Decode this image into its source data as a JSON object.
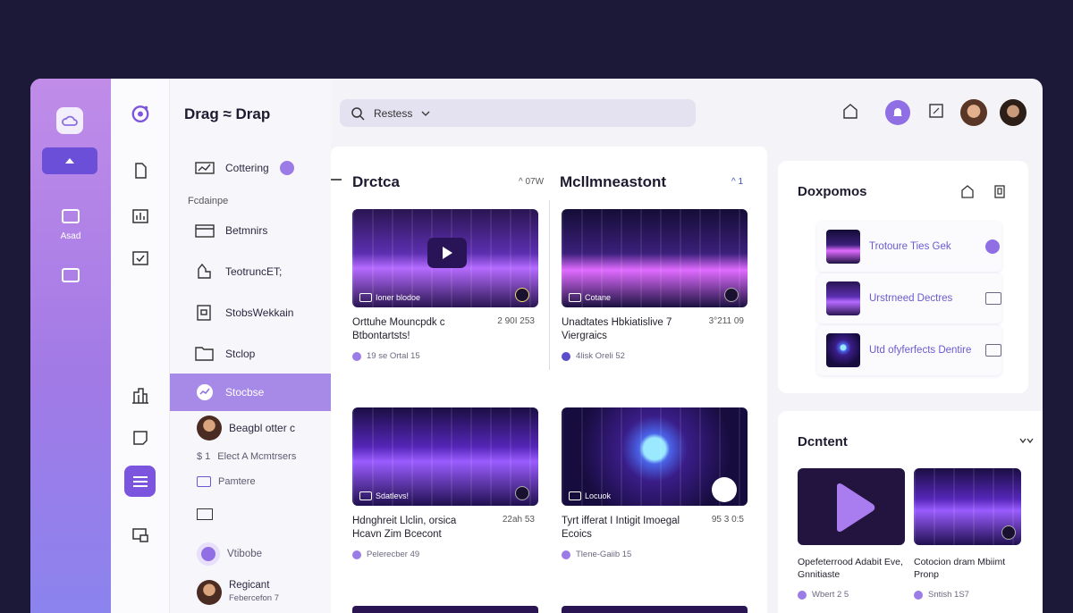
{
  "nav": {
    "brand": "Drag ≈ Drap",
    "rail_item_label": "Asad",
    "section_label": "Fcdainpe",
    "items": [
      {
        "label": "Cottering",
        "icon": "chart-icon"
      },
      {
        "label": "Betmnirs",
        "icon": "folder-icon"
      },
      {
        "label": "TeotruncET;",
        "icon": "upload-icon"
      },
      {
        "label": "StobsWekkain",
        "icon": "stack-icon"
      },
      {
        "label": "Stclop",
        "icon": "folder-icon"
      },
      {
        "label": "Stocbse",
        "icon": "chart-icon",
        "active": true
      }
    ],
    "sub_items": [
      {
        "label": "Beagbl otter c"
      },
      {
        "label": "Elect A Mcmtrsers"
      },
      {
        "label": "Pamtere"
      },
      {
        "label": "Vtibobe"
      },
      {
        "label": "Regicant",
        "sub": "Febercefon 7"
      }
    ]
  },
  "search": {
    "value": "Restess"
  },
  "main": {
    "left_section": {
      "title": "Drctca",
      "meta": "^ 07W"
    },
    "right_section": {
      "title": "Mcllmneastont",
      "meta": "^ 1"
    },
    "cards": [
      {
        "title": "Orttuhe Mouncpdk c Btbontartsts!",
        "stat": "2 90I 253",
        "meta": "19 se Ortal 15",
        "chip": "Ioner blodoe"
      },
      {
        "title": "Unadtates Hbkiatislive 7 Viergraics",
        "stat": "3°211 09",
        "meta": "4lisk Oreli 52",
        "chip": "Cotane"
      },
      {
        "title": "Hdnghreit Llclin, orsica Hcavn Zim Bcecont",
        "stat": "22ah 53",
        "meta": "Pelerecber 49",
        "chip": "Sdatlevs!"
      },
      {
        "title": "Tyrt ifferat I Intigit Imoegal Ecoics",
        "stat": "95 3 0:5",
        "meta": "Tlene-Gaiib 15",
        "chip": "Locuok"
      }
    ]
  },
  "right": {
    "panel_title": "Doxpomos",
    "items": [
      {
        "title": "Trotoure Ties Gek"
      },
      {
        "title": "Urstrneed Dectres"
      },
      {
        "title": "Utd ofyferfects Dentire"
      }
    ],
    "content_title": "Dcntent",
    "content_cards": [
      {
        "title": "Opefeterrood Adabit Eve, Gnnitiaste",
        "meta": "Wbert 2 5"
      },
      {
        "title": "Cotocion dram Mbiimt Pronp",
        "meta": "Sntish 1S7"
      }
    ]
  },
  "colors": {
    "accent": "#8f6fe3",
    "rail_top": "#c08ce8",
    "rail_bottom": "#8b83ee",
    "background": "#1c1838"
  }
}
